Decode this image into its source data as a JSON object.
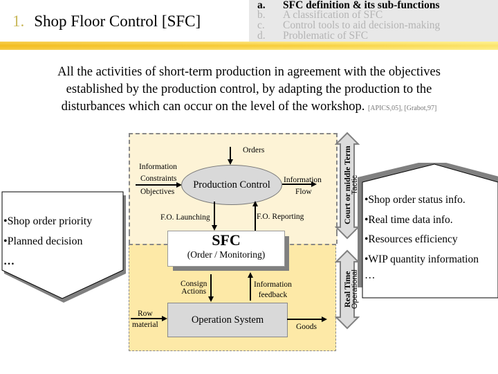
{
  "header": {
    "section_number": "1.",
    "section_title": "Shop Floor Control [SFC]",
    "outline": [
      {
        "letter": "a.",
        "label": "SFC definition & its sub-functions",
        "active": true
      },
      {
        "letter": "b.",
        "label": "A classification of SFC",
        "active": false
      },
      {
        "letter": "c.",
        "label": "Control tools to aid decision-making",
        "active": false
      },
      {
        "letter": "d.",
        "label": "Problematic of SFC",
        "active": false
      }
    ],
    "accent_color": "#f6c52b"
  },
  "definition": {
    "line1": "All the activities of short-term production in agreement with the objectives",
    "line2": "established by the production control, by adapting the production to the",
    "line3": "disturbances which can occur on the level of the workshop.",
    "references": "[APICS,05], [Grabot,97]"
  },
  "diagram": {
    "orders": "Orders",
    "input_labels": [
      "Information",
      "Constraints",
      "Objectives"
    ],
    "production_control": "Production Control",
    "info_flow": [
      "Information",
      "Flow"
    ],
    "fo_launching": "F.O. Launching",
    "fo_reporting": "F.O. Reporting",
    "sfc_title": "SFC",
    "sfc_subtitle": "(Order / Monitoring)",
    "consign_actions": [
      "Consign",
      "Actions"
    ],
    "info_feedback": [
      "Information",
      "feedback"
    ],
    "row_material": [
      "Row",
      "material"
    ],
    "operation_system": "Operation System",
    "goods": "Goods",
    "tactic_arrow": {
      "bold": "Court or middle Term",
      "normal": "Tactic"
    },
    "operational_arrow": {
      "bold": "Real Time",
      "normal": "Operational"
    },
    "colors": {
      "tactic_zone": "#fdf3d6",
      "operational_zone": "#fde9a7",
      "box_fill": "#d9d9d9"
    }
  },
  "left_panel": {
    "items": [
      "•Shop order priority",
      "•Planned decision",
      "…"
    ]
  },
  "right_panel": {
    "items": [
      "•Shop order status info.",
      "•Real time data info.",
      "•Resources efficiency",
      "•WIP quantity information",
      "…"
    ]
  }
}
